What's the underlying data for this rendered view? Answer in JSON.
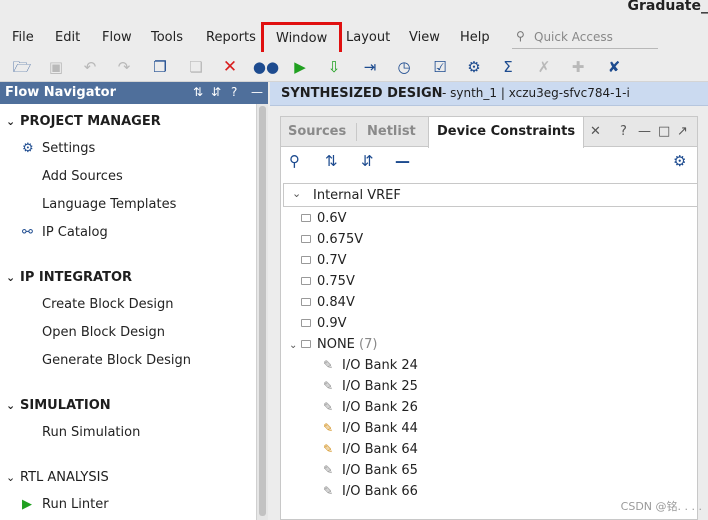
{
  "window": {
    "title": "Graduate_"
  },
  "menu": {
    "items": [
      "File",
      "Edit",
      "Flow",
      "Tools",
      "Reports",
      "Window",
      "Layout",
      "View",
      "Help"
    ],
    "highlighted": "Window",
    "highlight_color": "#e01010"
  },
  "quick_access": {
    "placeholder": "Quick Access",
    "icon": "search-icon"
  },
  "toolbar": {
    "icons": [
      "open-folder-icon",
      "save-icon",
      "undo-icon",
      "redo-icon",
      "copy-icon",
      "paste-icon",
      "delete-icon",
      "find-icon",
      "run-icon",
      "generate-bitstream-icon",
      "step-into-icon",
      "timer-icon",
      "report-icon",
      "settings-icon",
      "sigma-icon",
      "probe-icon",
      "wand-icon",
      "marker-icon"
    ]
  },
  "flow_navigator": {
    "title": "Flow Navigator",
    "header_color": "#4f6f9b",
    "sections": [
      {
        "title": "PROJECT MANAGER",
        "items": [
          {
            "label": "Settings",
            "icon": "gear-icon"
          },
          {
            "label": "Add Sources"
          },
          {
            "label": "Language Templates"
          },
          {
            "label": "IP Catalog",
            "icon": "ip-icon"
          }
        ]
      },
      {
        "title": "IP INTEGRATOR",
        "items": [
          {
            "label": "Create Block Design"
          },
          {
            "label": "Open Block Design"
          },
          {
            "label": "Generate Block Design"
          }
        ]
      },
      {
        "title": "SIMULATION",
        "items": [
          {
            "label": "Run Simulation"
          }
        ]
      },
      {
        "title": "RTL ANALYSIS",
        "items": [
          {
            "label": "Run Linter",
            "icon": "play-icon"
          }
        ]
      }
    ]
  },
  "design": {
    "banner_title": "SYNTHESIZED DESIGN",
    "banner_sub": "- synth_1 | xczu3eg-sfvc784-1-i",
    "banner_color": "#cbdaf0"
  },
  "tabs": {
    "items": [
      "Sources",
      "Netlist",
      "Device Constraints"
    ],
    "active": "Device Constraints"
  },
  "tree": {
    "root": "Internal VREF",
    "vref_folders": [
      "0.6V",
      "0.675V",
      "0.7V",
      "0.75V",
      "0.84V",
      "0.9V"
    ],
    "none_group": {
      "label": "NONE",
      "count": "(7)"
    },
    "banks": [
      "I/O Bank 24",
      "I/O Bank 25",
      "I/O Bank 26",
      "I/O Bank 44",
      "I/O Bank 64",
      "I/O Bank 65",
      "I/O Bank 66"
    ]
  },
  "watermark": "CSDN @铭. . . ."
}
